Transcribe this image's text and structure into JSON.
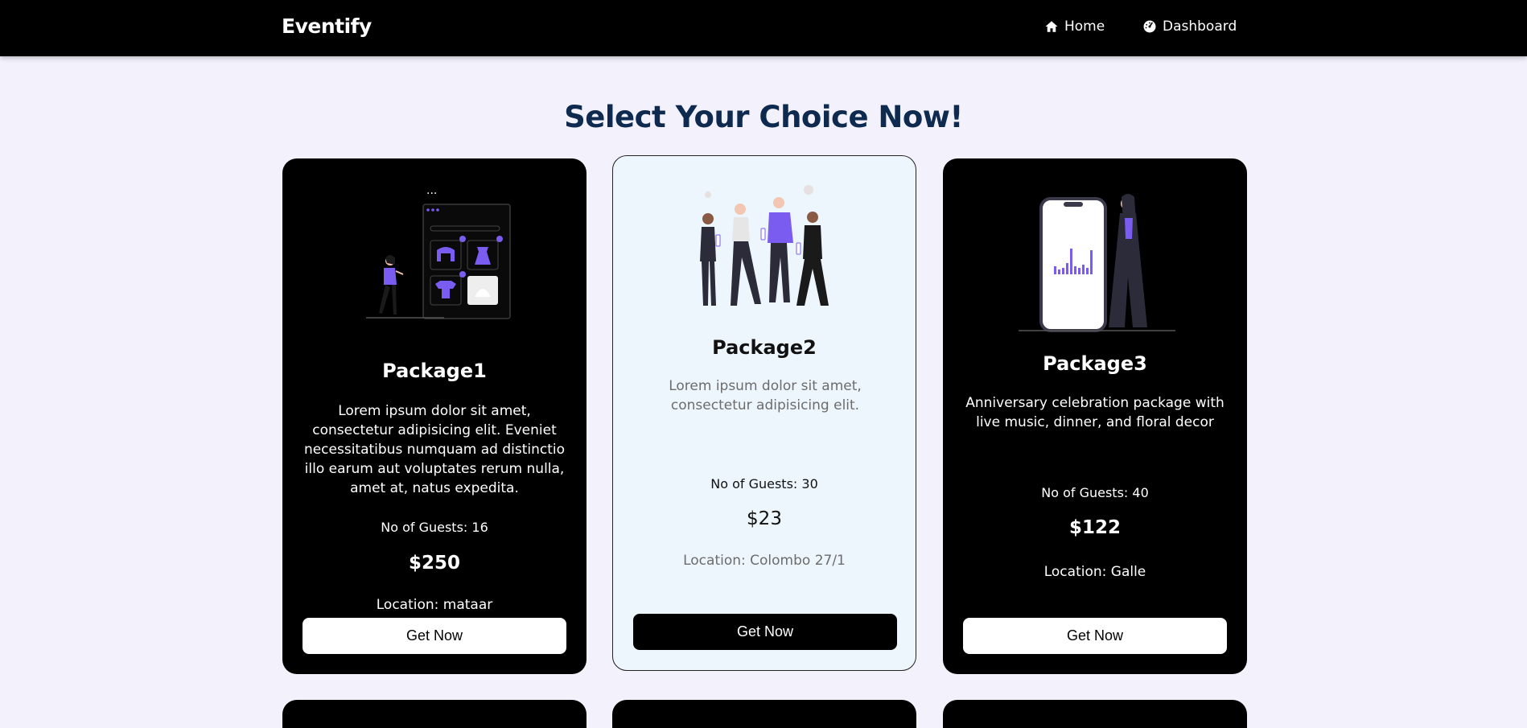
{
  "navbar": {
    "brand": "Eventify",
    "links": [
      {
        "label": "Home",
        "icon": "home-icon"
      },
      {
        "label": "Dashboard",
        "icon": "dashboard-icon"
      }
    ]
  },
  "page_title": "Select Your Choice Now!",
  "packages": [
    {
      "name": "Package1",
      "description": "Lorem ipsum dolor sit amet, consectetur adipisicing elit. Eveniet necessitatibus numquam ad distinctio illo earum aut voluptates rerum nulla, amet at, natus expedita.",
      "guests": "No of Guests: 16",
      "price": "$250",
      "location": "Location: mataar",
      "button": "Get Now",
      "illustration": "online-shopping-illustration"
    },
    {
      "name": "Package2",
      "description": "Lorem ipsum dolor sit amet, consectetur adipisicing elit.",
      "guests": "No of Guests: 30",
      "price": "$23",
      "location": "Location: Colombo 27/1",
      "button": "Get Now",
      "illustration": "party-people-illustration"
    },
    {
      "name": "Package3",
      "description": "Anniversary celebration package with live music, dinner, and floral decor",
      "guests": "No of Guests: 40",
      "price": "$122",
      "location": "Location: Galle",
      "button": "Get Now",
      "illustration": "phone-analytics-illustration"
    }
  ],
  "colors": {
    "background": "#f3f2fc",
    "navbar": "#000000",
    "title": "#0e2a4f",
    "accent": "#7b5cf0",
    "light_card": "#eef6fd"
  }
}
